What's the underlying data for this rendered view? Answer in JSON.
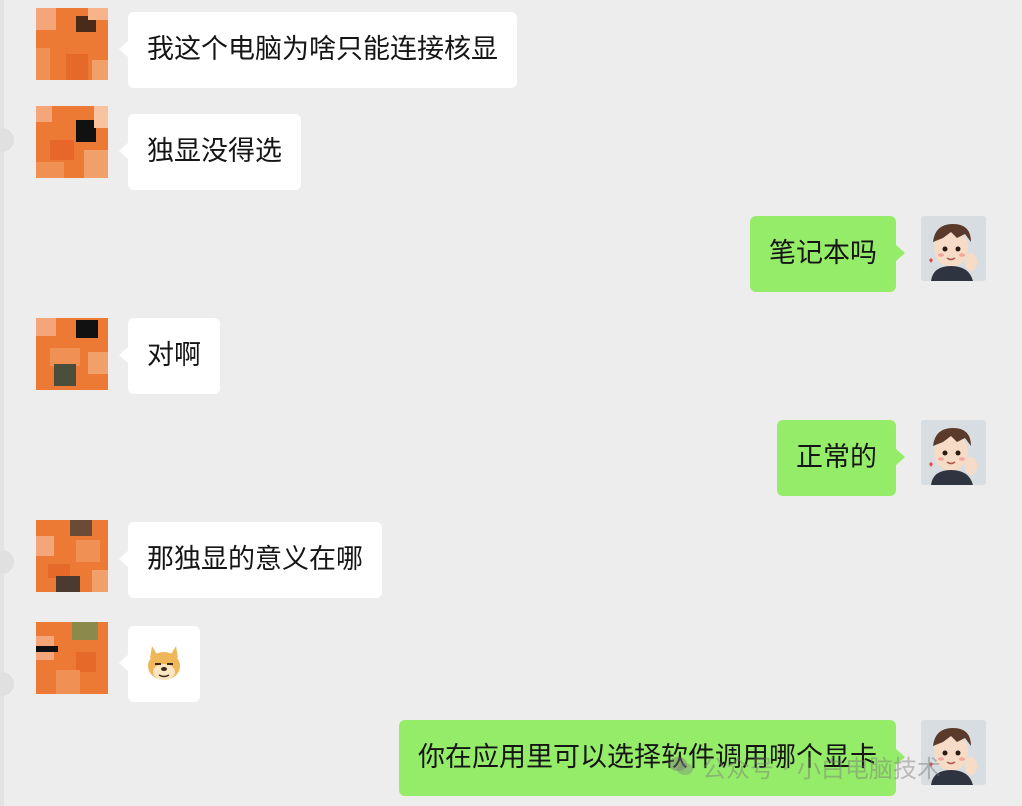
{
  "colors": {
    "background": "#ededed",
    "incoming_bubble": "#ffffff",
    "outgoing_bubble": "#95ec69"
  },
  "messages": [
    {
      "side": "in",
      "text": "我这个电脑为啥只能连接核显",
      "avatar": "pixelated-avatar-icon"
    },
    {
      "side": "in",
      "text": "独显没得选",
      "avatar": "pixelated-avatar-icon"
    },
    {
      "side": "out",
      "text": "笔记本吗",
      "avatar": "cartoon-boy-avatar-icon"
    },
    {
      "side": "in",
      "text": "对啊",
      "avatar": "pixelated-avatar-icon"
    },
    {
      "side": "out",
      "text": "正常的",
      "avatar": "cartoon-boy-avatar-icon"
    },
    {
      "side": "in",
      "text": "那独显的意义在哪",
      "avatar": "pixelated-avatar-icon"
    },
    {
      "side": "in",
      "text": "",
      "emoji": "doge-emoji-icon",
      "avatar": "pixelated-avatar-icon"
    },
    {
      "side": "out",
      "text": "你在应用里可以选择软件调用哪个显卡",
      "avatar": "cartoon-boy-avatar-icon"
    }
  ],
  "watermark": {
    "text": "公众号 · 小白电脑技术",
    "icon": "wechat-icon"
  }
}
